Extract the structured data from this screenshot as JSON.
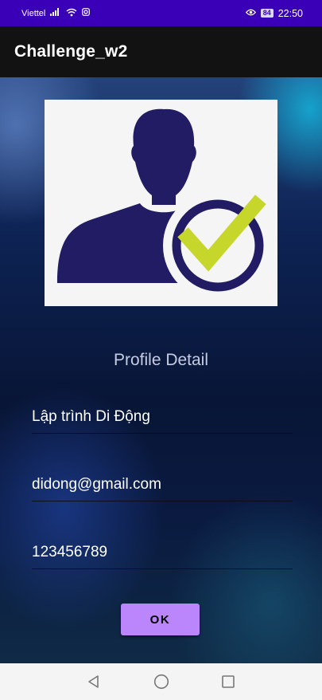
{
  "status_bar": {
    "carrier": "Viettel",
    "battery": "84",
    "time": "22:50"
  },
  "app_bar": {
    "title": "Challenge_w2"
  },
  "profile": {
    "image_icon": "user-verified-icon",
    "heading": "Profile Detail",
    "name": "Lập trình Di Động",
    "email": "didong@gmail.com",
    "phone": "123456789",
    "ok_label": "OK"
  },
  "colors": {
    "status_bar": "#3a00b8",
    "app_bar": "#121212",
    "accent_button": "#bb86fc",
    "icon_silhouette": "#211c63",
    "icon_check": "#c6d62b"
  }
}
